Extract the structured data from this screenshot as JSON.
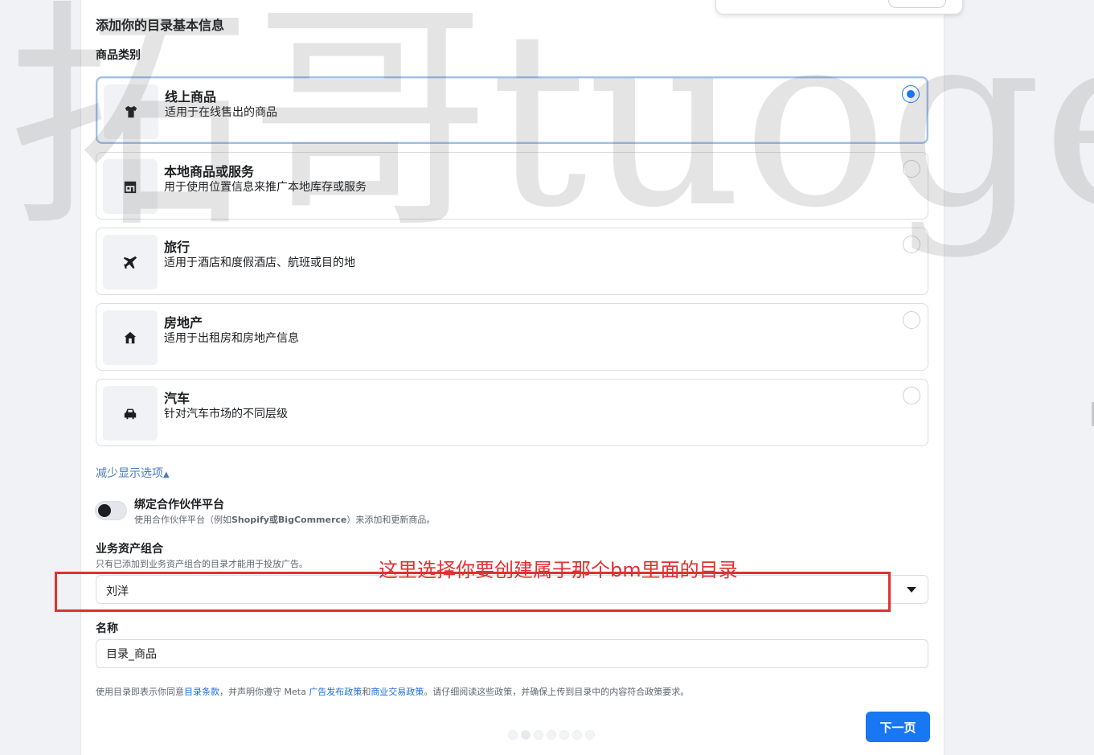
{
  "heading": "添加你的目录基本信息",
  "category_label": "商品类别",
  "options": [
    {
      "title": "线上商品",
      "desc": "适用于在线售出的商品",
      "icon": "shirt-icon",
      "selected": true
    },
    {
      "title": "本地商品或服务",
      "desc": "用于使用位置信息来推广本地库存或服务",
      "icon": "storefront-icon",
      "selected": false
    },
    {
      "title": "旅行",
      "desc": "适用于酒店和度假酒店、航班或目的地",
      "icon": "airplane-icon",
      "selected": false
    },
    {
      "title": "房地产",
      "desc": "适用于出租房和房地产信息",
      "icon": "house-icon",
      "selected": false
    },
    {
      "title": "汽车",
      "desc": "针对汽车市场的不同层级",
      "icon": "car-icon",
      "selected": false
    }
  ],
  "show_less": "减少显示选项",
  "partner": {
    "title": "绑定合作伙伴平台",
    "desc_prefix": "使用合作伙伴平台（例如",
    "desc_brands": "Shopify或BigCommerce",
    "desc_suffix": "）来添加和更新商品。",
    "enabled": false
  },
  "business_set": {
    "title": "业务资产组合",
    "desc": "只有已添加到业务资产组合的目录才能用于投放广告。",
    "value": "刘洋"
  },
  "name": {
    "label": "名称",
    "value": "目录_商品"
  },
  "legal": {
    "part1": "使用目录即表示你同意",
    "link1": "目录条款",
    "part2": "，并声明你遵守 Meta ",
    "link2": "广告发布政策",
    "part3": "和",
    "link3": "商业交易政策",
    "part4": "。请仔细阅读这些政策，并确保上传到目录中的内容符合政策要求。"
  },
  "next_button": "下一页",
  "annotation": "这里选择你要创建属于那个bm里面的目录",
  "watermark": "拓哥tuoge",
  "colors": {
    "accent": "#1877f2",
    "annotation": "#e03131"
  }
}
